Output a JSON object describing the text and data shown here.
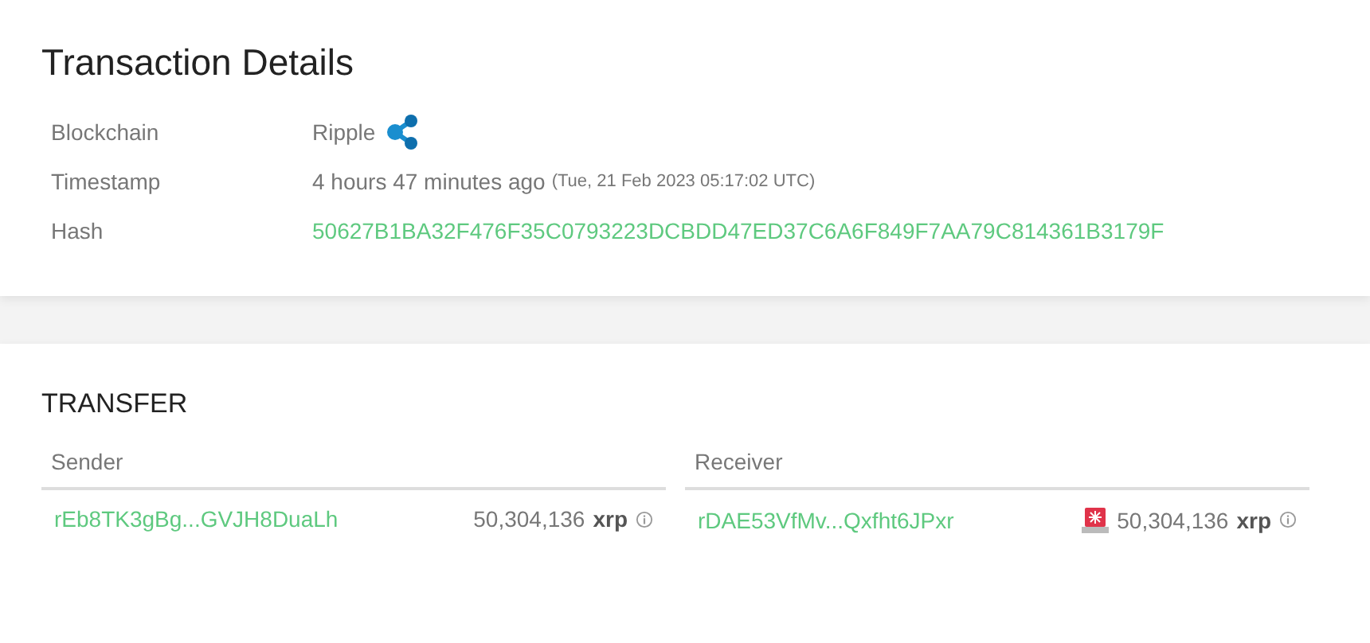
{
  "details": {
    "title": "Transaction Details",
    "rows": [
      {
        "kind": "chain",
        "label": "Blockchain",
        "value": "Ripple"
      },
      {
        "kind": "time",
        "label": "Timestamp",
        "value": "4 hours 47 minutes ago",
        "note": "(Tue, 21 Feb 2023 05:17:02 UTC)"
      },
      {
        "kind": "hash",
        "label": "Hash",
        "value": "50627B1BA32F476F35C0793223DCBDD47ED37C6A6F849F7AA79C814361B3179F"
      }
    ]
  },
  "transfer": {
    "title": "TRANSFER",
    "parties": [
      {
        "heading": "Sender",
        "address": "rEb8TK3gBg...GVJH8DuaLh",
        "amount": "50,304,136",
        "unit": "xrp",
        "alert": false
      },
      {
        "heading": "Receiver",
        "address": "rDAE53VfMv...Qxfht6JPxr",
        "amount": "50,304,136",
        "unit": "xrp",
        "alert": true
      }
    ]
  }
}
